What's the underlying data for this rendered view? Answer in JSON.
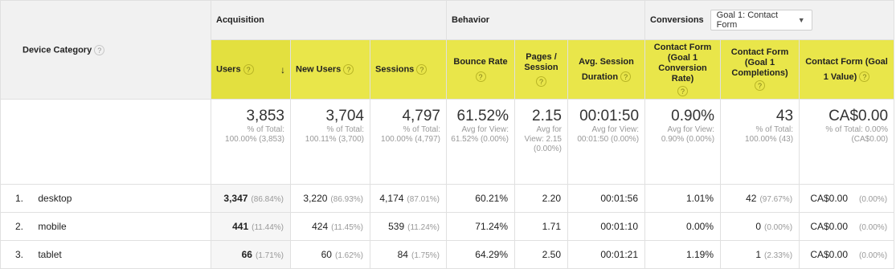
{
  "dimension": {
    "label": "Device Category"
  },
  "groups": {
    "acquisition": "Acquisition",
    "behavior": "Behavior",
    "conversions": "Conversions"
  },
  "goal_select": {
    "value": "Goal 1: Contact Form"
  },
  "columns": {
    "users": "Users",
    "new_users": "New Users",
    "sessions": "Sessions",
    "bounce_rate": "Bounce Rate",
    "pages_session": "Pages / Session",
    "avg_duration": "Avg. Session Duration",
    "conv_rate": "Contact Form (Goal 1 Conversion Rate)",
    "completions": "Contact Form (Goal 1 Completions)",
    "value": "Contact Form (Goal 1 Value)"
  },
  "totals": {
    "users": {
      "value": "3,853",
      "sub": "% of Total: 100.00% (3,853)"
    },
    "new_users": {
      "value": "3,704",
      "sub": "% of Total: 100.11% (3,700)"
    },
    "sessions": {
      "value": "4,797",
      "sub": "% of Total: 100.00% (4,797)"
    },
    "bounce_rate": {
      "value": "61.52%",
      "sub": "Avg for View: 61.52% (0.00%)"
    },
    "pages_session": {
      "value": "2.15",
      "sub": "Avg for View: 2.15 (0.00%)"
    },
    "avg_duration": {
      "value": "00:01:50",
      "sub": "Avg for View: 00:01:50 (0.00%)"
    },
    "conv_rate": {
      "value": "0.90%",
      "sub": "Avg for View: 0.90% (0.00%)"
    },
    "completions": {
      "value": "43",
      "sub": "% of Total: 100.00% (43)"
    },
    "value": {
      "value": "CA$0.00",
      "sub": "% of Total: 0.00% (CA$0.00)"
    }
  },
  "rows": [
    {
      "index": "1.",
      "device": "desktop",
      "users": "3,347",
      "users_pct": "(86.84%)",
      "new_users": "3,220",
      "new_users_pct": "(86.93%)",
      "sessions": "4,174",
      "sessions_pct": "(87.01%)",
      "bounce_rate": "60.21%",
      "pages_session": "2.20",
      "avg_duration": "00:01:56",
      "conv_rate": "1.01%",
      "completions": "42",
      "completions_pct": "(97.67%)",
      "value": "CA$0.00",
      "value_pct": "(0.00%)"
    },
    {
      "index": "2.",
      "device": "mobile",
      "users": "441",
      "users_pct": "(11.44%)",
      "new_users": "424",
      "new_users_pct": "(11.45%)",
      "sessions": "539",
      "sessions_pct": "(11.24%)",
      "bounce_rate": "71.24%",
      "pages_session": "1.71",
      "avg_duration": "00:01:10",
      "conv_rate": "0.00%",
      "completions": "0",
      "completions_pct": "(0.00%)",
      "value": "CA$0.00",
      "value_pct": "(0.00%)"
    },
    {
      "index": "3.",
      "device": "tablet",
      "users": "66",
      "users_pct": "(1.71%)",
      "new_users": "60",
      "new_users_pct": "(1.62%)",
      "sessions": "84",
      "sessions_pct": "(1.75%)",
      "bounce_rate": "64.29%",
      "pages_session": "2.50",
      "avg_duration": "00:01:21",
      "conv_rate": "1.19%",
      "completions": "1",
      "completions_pct": "(2.33%)",
      "value": "CA$0.00",
      "value_pct": "(0.00%)"
    }
  ]
}
